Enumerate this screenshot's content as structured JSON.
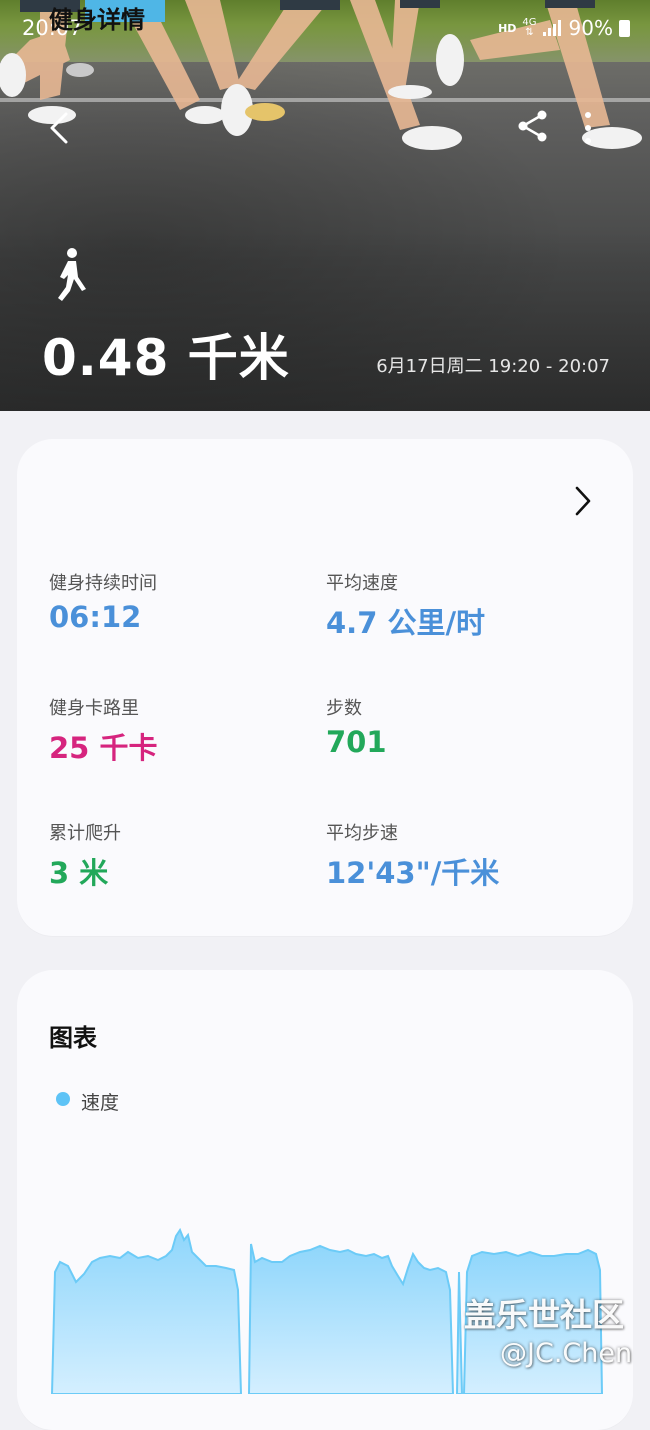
{
  "status_bar": {
    "time": "20:07",
    "hd": "HD",
    "network": "4G",
    "battery": "90%"
  },
  "hero": {
    "distance": "0.48 千米",
    "time_range": "6月17日周二 19:20 - 20:07",
    "activity_icon": "walking-person-icon"
  },
  "toolbar": {
    "back_icon": "back-arrow-icon",
    "share_icon": "share-icon",
    "more_icon": "more-vertical-icon"
  },
  "details": {
    "title": "健身详情",
    "metrics": [
      {
        "label": "健身持续时间",
        "value": "06:12",
        "color": "#4a90d9"
      },
      {
        "label": "平均速度",
        "value": "4.7 公里/时",
        "color": "#4a90d9"
      },
      {
        "label": "健身卡路里",
        "value": "25 千卡",
        "color": "#d6247e"
      },
      {
        "label": "步数",
        "value": "701",
        "color": "#22a85a"
      },
      {
        "label": "累计爬升",
        "value": "3 米",
        "color": "#22a85a"
      },
      {
        "label": "平均步速",
        "value": "12'43\"/千米",
        "color": "#4a90d9"
      }
    ]
  },
  "chart": {
    "title": "图表",
    "legend": "速度",
    "series_color": "#5ec3f6"
  },
  "watermark": {
    "line1": "盖乐世社区",
    "line2": "@JC.Chen"
  }
}
